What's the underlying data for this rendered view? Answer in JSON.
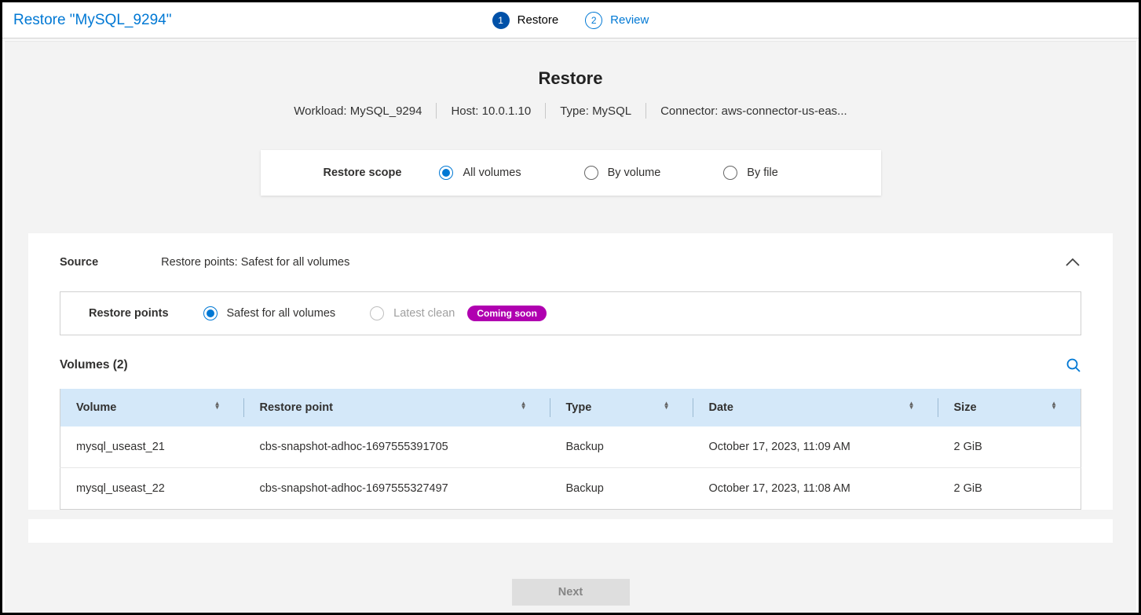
{
  "page_title": "Restore \"MySQL_9294\"",
  "steps": [
    {
      "num": "1",
      "label": "Restore",
      "state": "active"
    },
    {
      "num": "2",
      "label": "Review",
      "state": "pending"
    }
  ],
  "header": {
    "title": "Restore",
    "meta": {
      "workload_label": "Workload: ",
      "workload_value": "MySQL_9294",
      "host_label": "Host: ",
      "host_value": "10.0.1.10",
      "type_label": "Type: ",
      "type_value": "MySQL",
      "connector_label": "Connector: ",
      "connector_value": "aws-connector-us-eas..."
    }
  },
  "scope": {
    "label": "Restore scope",
    "options": {
      "all": "All volumes",
      "by_volume": "By volume",
      "by_file": "By file"
    },
    "selected": "all"
  },
  "source": {
    "label": "Source",
    "value": "Restore points: Safest for all volumes"
  },
  "restore_points": {
    "label": "Restore points",
    "safest": "Safest for all volumes",
    "latest": "Latest clean",
    "badge": "Coming soon"
  },
  "volumes": {
    "title": "Volumes (2)",
    "columns": {
      "volume": "Volume",
      "restore_point": "Restore point",
      "type": "Type",
      "date": "Date",
      "size": "Size"
    },
    "rows": [
      {
        "volume": "mysql_useast_21",
        "restore_point": "cbs-snapshot-adhoc-1697555391705",
        "type": "Backup",
        "date": "October 17, 2023, 11:09 AM",
        "size": "2 GiB"
      },
      {
        "volume": "mysql_useast_22",
        "restore_point": "cbs-snapshot-adhoc-1697555327497",
        "type": "Backup",
        "date": "October 17, 2023, 11:08 AM",
        "size": "2 GiB"
      }
    ]
  },
  "footer": {
    "next": "Next"
  }
}
